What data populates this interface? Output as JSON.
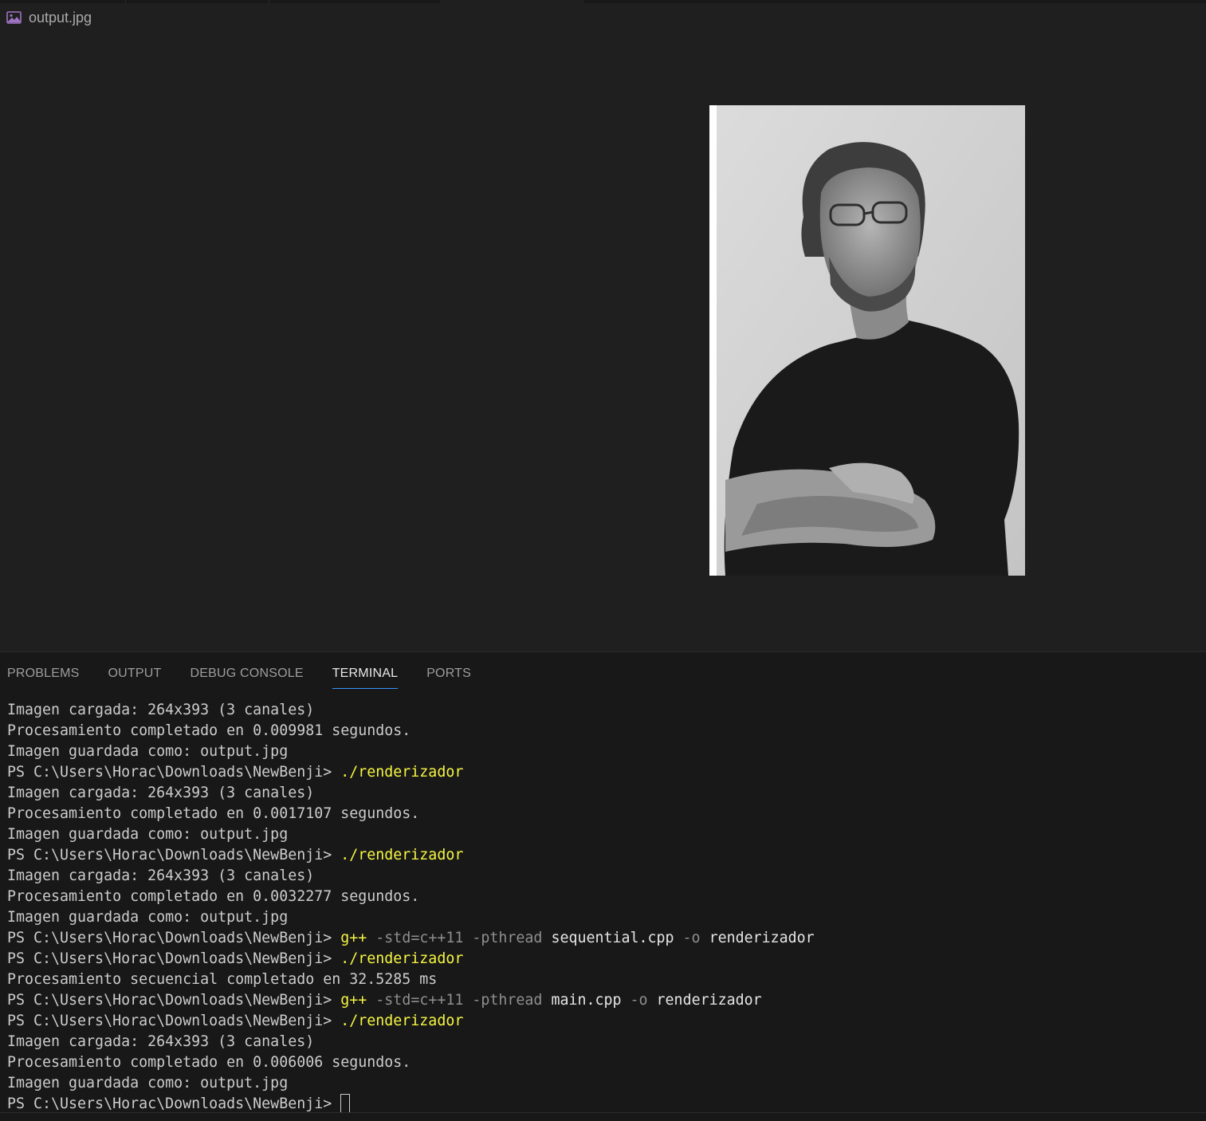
{
  "editor": {
    "file_name": "output.jpg",
    "file_icon": "image-file-icon",
    "image_description_icon": "preview-image"
  },
  "panel": {
    "tabs": [
      {
        "label": "PROBLEMS",
        "active": false
      },
      {
        "label": "OUTPUT",
        "active": false
      },
      {
        "label": "DEBUG CONSOLE",
        "active": false
      },
      {
        "label": "TERMINAL",
        "active": true
      },
      {
        "label": "PORTS",
        "active": false
      }
    ]
  },
  "terminal": {
    "prompt": "PS C:\\Users\\Horac\\Downloads\\NewBenji>",
    "lines": [
      {
        "type": "out",
        "text": "Imagen cargada: 264x393 (3 canales)"
      },
      {
        "type": "out",
        "text": "Procesamiento completado en 0.009981 segundos."
      },
      {
        "type": "out",
        "text": "Imagen guardada como: output.jpg"
      },
      {
        "type": "cmd",
        "cmd": "./renderizador",
        "flags1": "",
        "arg1": "",
        "flags2": "",
        "arg2": ""
      },
      {
        "type": "out",
        "text": "Imagen cargada: 264x393 (3 canales)"
      },
      {
        "type": "out",
        "text": "Procesamiento completado en 0.0017107 segundos."
      },
      {
        "type": "out",
        "text": "Imagen guardada como: output.jpg"
      },
      {
        "type": "cmd",
        "cmd": "./renderizador",
        "flags1": "",
        "arg1": "",
        "flags2": "",
        "arg2": ""
      },
      {
        "type": "out",
        "text": "Imagen cargada: 264x393 (3 canales)"
      },
      {
        "type": "out",
        "text": "Procesamiento completado en 0.0032277 segundos."
      },
      {
        "type": "out",
        "text": "Imagen guardada como: output.jpg"
      },
      {
        "type": "cmd",
        "cmd": "g++",
        "flags1": "-std=c++11 -pthread",
        "arg1": "sequential.cpp",
        "flags2": "-o",
        "arg2": "renderizador"
      },
      {
        "type": "cmd",
        "cmd": "./renderizador",
        "flags1": "",
        "arg1": "",
        "flags2": "",
        "arg2": ""
      },
      {
        "type": "out",
        "text": "Procesamiento secuencial completado en 32.5285 ms"
      },
      {
        "type": "cmd",
        "cmd": "g++",
        "flags1": "-std=c++11 -pthread",
        "arg1": "main.cpp",
        "flags2": "-o",
        "arg2": "renderizador"
      },
      {
        "type": "cmd",
        "cmd": "./renderizador",
        "flags1": "",
        "arg1": "",
        "flags2": "",
        "arg2": ""
      },
      {
        "type": "out",
        "text": "Imagen cargada: 264x393 (3 canales)"
      },
      {
        "type": "out",
        "text": "Procesamiento completado en 0.006006 segundos."
      },
      {
        "type": "out",
        "text": "Imagen guardada como: output.jpg"
      },
      {
        "type": "prompt"
      }
    ]
  },
  "colors": {
    "editor_bg": "#1f1f1f",
    "panel_bg": "#181818",
    "command": "#f5f543",
    "flag": "#8f8f8f",
    "active_tab_underline": "#3794ff"
  }
}
